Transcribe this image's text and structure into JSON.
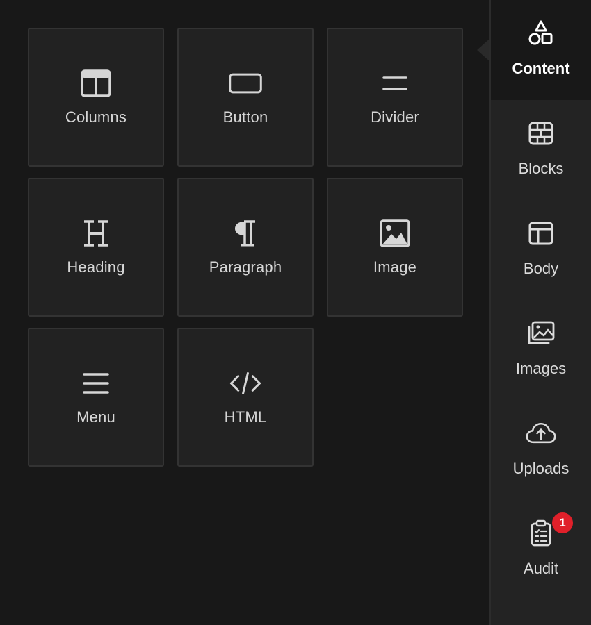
{
  "tiles": [
    {
      "label": "Columns",
      "icon": "columns-icon"
    },
    {
      "label": "Button",
      "icon": "button-icon"
    },
    {
      "label": "Divider",
      "icon": "divider-icon"
    },
    {
      "label": "Heading",
      "icon": "heading-icon"
    },
    {
      "label": "Paragraph",
      "icon": "paragraph-icon"
    },
    {
      "label": "Image",
      "icon": "image-icon"
    },
    {
      "label": "Menu",
      "icon": "menu-icon"
    },
    {
      "label": "HTML",
      "icon": "code-icon"
    }
  ],
  "sidebar": {
    "items": [
      {
        "label": "Content",
        "icon": "shapes-icon",
        "active": true
      },
      {
        "label": "Blocks",
        "icon": "bricks-icon"
      },
      {
        "label": "Body",
        "icon": "layout-icon"
      },
      {
        "label": "Images",
        "icon": "gallery-icon"
      },
      {
        "label": "Uploads",
        "icon": "cloud-upload-icon"
      },
      {
        "label": "Audit",
        "icon": "clipboard-check-icon",
        "badge": "1"
      }
    ]
  },
  "colors": {
    "background": "#181818",
    "tile_bg": "#222222",
    "tile_border": "#333333",
    "sidebar_bg": "#232323",
    "badge": "#e0202a",
    "icon": "#dcdcdc"
  }
}
